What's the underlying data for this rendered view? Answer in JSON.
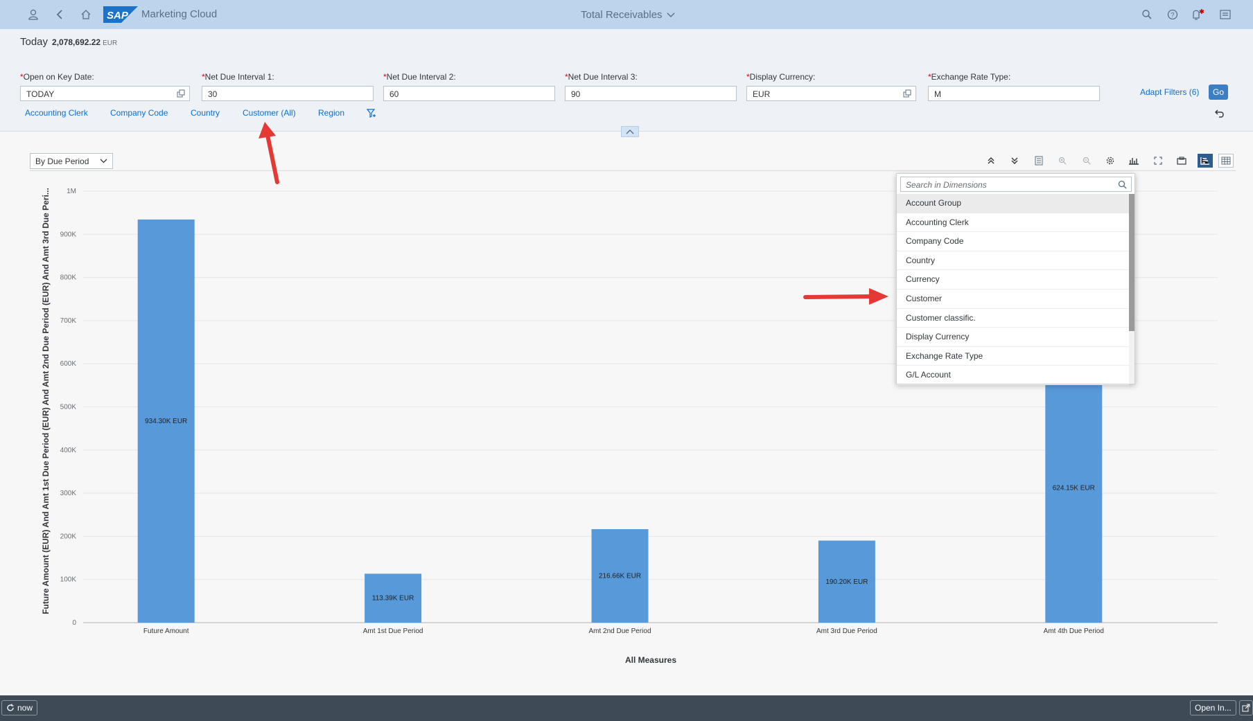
{
  "shell": {
    "app_title": "Marketing Cloud",
    "page_title": "Total Receivables",
    "logo_text": "SAP",
    "icons": [
      "user-icon",
      "back-icon",
      "home-icon",
      "search-icon",
      "help-icon",
      "notification-icon",
      "menu-icon"
    ]
  },
  "kpi": {
    "label": "Today",
    "value": "2,078,692.22",
    "currency": "EUR"
  },
  "filters": [
    {
      "label": "Open on Key Date:",
      "value": "TODAY"
    },
    {
      "label": "Net Due Interval 1:",
      "value": "30"
    },
    {
      "label": "Net Due Interval 2:",
      "value": "60"
    },
    {
      "label": "Net Due Interval 3:",
      "value": "90"
    },
    {
      "label": "Display Currency:",
      "value": "EUR"
    },
    {
      "label": "Exchange Rate Type:",
      "value": "M"
    }
  ],
  "required_marker": "*",
  "filter_links": [
    "Accounting Clerk",
    "Company Code",
    "Country",
    "Customer (All)",
    "Region"
  ],
  "adapt_filters": "Adapt Filters (6)",
  "go_label": "Go",
  "view_select": "By Due Period",
  "dropdown": {
    "placeholder": "Search in Dimensions",
    "items": [
      "Account Group",
      "Accounting Clerk",
      "Company Code",
      "Country",
      "Currency",
      "Customer",
      "Customer classific.",
      "Display Currency",
      "Exchange Rate Type",
      "G/L Account"
    ]
  },
  "footer": {
    "refresh_label": "now",
    "open_in_label": "Open In..."
  },
  "colors": {
    "shell": "#bcd5ec",
    "bar": "#5899da",
    "link": "#0a6ed1",
    "arrow": "#e53935"
  },
  "chart_data": {
    "type": "bar",
    "categories": [
      "Future Amount",
      "Amt 1st Due Period",
      "Amt 2nd Due Period",
      "Amt 3rd Due Period",
      "Amt 4th Due Period"
    ],
    "values": [
      934300,
      113390,
      216660,
      190200,
      624150
    ],
    "data_labels": [
      "934.30K EUR",
      "113.39K EUR",
      "216.66K EUR",
      "190.20K EUR",
      "624.15K EUR"
    ],
    "y_ticks": [
      "0",
      "100K",
      "200K",
      "300K",
      "400K",
      "500K",
      "600K",
      "700K",
      "800K",
      "900K",
      "1M"
    ],
    "ylim": [
      0,
      1000000
    ],
    "xlabel": "All Measures",
    "ylabel": "Future Amount (EUR) And Amt 1st Due Period (EUR) And Amt 2nd Due Period (EUR) And Amt 3rd Due Peri...",
    "grid": true
  }
}
